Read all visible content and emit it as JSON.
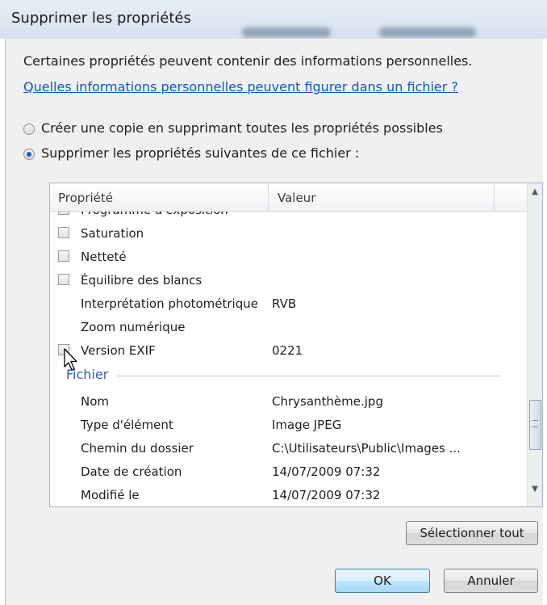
{
  "window": {
    "title": "Supprimer les propriétés"
  },
  "info": {
    "text": "Certaines propriétés peuvent contenir des informations personnelles.",
    "link": "Quelles informations personnelles peuvent figurer dans un fichier ?"
  },
  "options": {
    "copy_label": "Créer une copie en supprimant toutes les propriétés possibles",
    "copy_selected": false,
    "remove_label": "Supprimer les propriétés suivantes de ce fichier :",
    "remove_selected": true
  },
  "table": {
    "col_property": "Propriété",
    "col_value": "Valeur",
    "rows": [
      {
        "name": "Programme d'exposition",
        "value": "",
        "checkbox": true
      },
      {
        "name": "Saturation",
        "value": "",
        "checkbox": true
      },
      {
        "name": "Netteté",
        "value": "",
        "checkbox": true
      },
      {
        "name": "Équilibre des blancs",
        "value": "",
        "checkbox": true
      },
      {
        "name": "Interprétation photométrique",
        "value": "RVB",
        "checkbox": false
      },
      {
        "name": "Zoom numérique",
        "value": "",
        "checkbox": false
      },
      {
        "name": "Version EXIF",
        "value": "0221",
        "checkbox": true
      }
    ],
    "group": "Fichier",
    "file_rows": [
      {
        "name": "Nom",
        "value": "Chrysanthème.jpg"
      },
      {
        "name": "Type d'élément",
        "value": "Image JPEG"
      },
      {
        "name": "Chemin du dossier",
        "value": "C:\\Utilisateurs\\Public\\Images ..."
      },
      {
        "name": "Date de création",
        "value": "14/07/2009 07:32"
      },
      {
        "name": "Modifié le",
        "value": "14/07/2009 07:32"
      }
    ]
  },
  "buttons": {
    "select_all": "Sélectionner tout",
    "ok": "OK",
    "cancel": "Annuler"
  }
}
